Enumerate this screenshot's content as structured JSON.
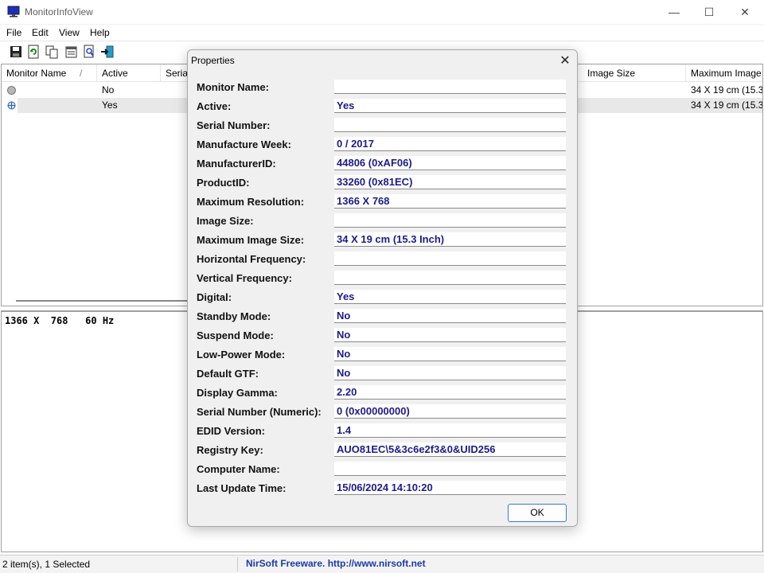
{
  "window": {
    "title": "MonitorInfoView",
    "minimize": "—",
    "maximize": "☐",
    "close": "✕"
  },
  "menu": [
    "File",
    "Edit",
    "View",
    "Help"
  ],
  "toolbar": [
    "save-icon",
    "refresh-icon",
    "copy-icon",
    "properties-icon",
    "find-icon",
    "exit-icon"
  ],
  "list": {
    "columns": [
      "Monitor Name",
      "Active",
      "Serial",
      "Image Size",
      "Maximum Image"
    ],
    "sort_indicator": "/",
    "rows": [
      {
        "name": "",
        "active": "No",
        "max_image": "34 X 19 cm (15.3"
      },
      {
        "name": "",
        "active": "Yes",
        "max_image": "34 X 19 cm (15.3"
      }
    ]
  },
  "lower": {
    "text": "1366 X  768   60 Hz"
  },
  "status": {
    "items": "2 item(s), 1 Selected",
    "link": "NirSoft Freeware.  http://www.nirsoft.net"
  },
  "dialog": {
    "title": "Properties",
    "close": "✕",
    "ok": "OK",
    "properties": [
      {
        "label": "Monitor Name:",
        "value": ""
      },
      {
        "label": "Active:",
        "value": "Yes"
      },
      {
        "label": "Serial Number:",
        "value": ""
      },
      {
        "label": "Manufacture Week:",
        "value": "0 / 2017"
      },
      {
        "label": "ManufacturerID:",
        "value": "44806 (0xAF06)"
      },
      {
        "label": "ProductID:",
        "value": "33260 (0x81EC)"
      },
      {
        "label": "Maximum Resolution:",
        "value": "1366 X 768"
      },
      {
        "label": "Image Size:",
        "value": ""
      },
      {
        "label": "Maximum Image Size:",
        "value": "34 X 19 cm (15.3 Inch)"
      },
      {
        "label": "Horizontal Frequency:",
        "value": ""
      },
      {
        "label": "Vertical Frequency:",
        "value": ""
      },
      {
        "label": "Digital:",
        "value": "Yes"
      },
      {
        "label": "Standby Mode:",
        "value": "No"
      },
      {
        "label": "Suspend Mode:",
        "value": "No"
      },
      {
        "label": "Low-Power Mode:",
        "value": "No"
      },
      {
        "label": "Default GTF:",
        "value": "No"
      },
      {
        "label": "Display Gamma:",
        "value": "2.20"
      },
      {
        "label": "Serial Number (Numeric):",
        "value": "0 (0x00000000)"
      },
      {
        "label": "EDID Version:",
        "value": "1.4"
      },
      {
        "label": "Registry Key:",
        "value": "AUO81EC\\5&3c6e2f3&0&UID256"
      },
      {
        "label": "Computer Name:",
        "value": ""
      },
      {
        "label": "Last Update Time:",
        "value": "15/06/2024 14:10:20"
      }
    ]
  }
}
